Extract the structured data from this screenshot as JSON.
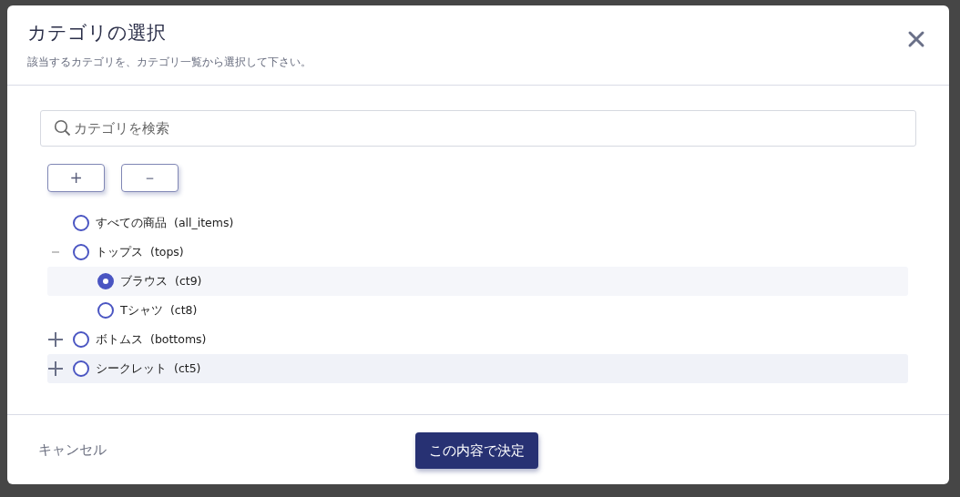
{
  "dialog": {
    "title": "カテゴリの選択",
    "subtitle": "該当するカテゴリを、カテゴリ一覧から選択して下さい。"
  },
  "search": {
    "placeholder": "カテゴリを検索"
  },
  "expand_all_button": "+",
  "collapse_all_button": "－",
  "tree": [
    {
      "label": "すべての商品",
      "code": "(all_items)",
      "kind": "leaf",
      "selected": false,
      "hovered": false
    },
    {
      "label": "トップス",
      "code": "(tops)",
      "kind": "branch",
      "selected": false,
      "hovered": false,
      "expanded": true,
      "children": [
        {
          "label": "ブラウス",
          "code": "(ct9)",
          "kind": "leaf",
          "selected": true,
          "hovered": false
        },
        {
          "label": "Tシャツ",
          "code": "(ct8)",
          "kind": "leaf",
          "selected": false,
          "hovered": false
        }
      ]
    },
    {
      "label": "ボトムス",
      "code": "(bottoms)",
      "kind": "branch",
      "selected": false,
      "hovered": false,
      "expanded": false
    },
    {
      "label": "シークレット",
      "code": "(ct5)",
      "kind": "branch",
      "selected": false,
      "hovered": true,
      "expanded": false
    }
  ],
  "footer": {
    "cancel": "キャンセル",
    "confirm": "この内容で決定"
  }
}
